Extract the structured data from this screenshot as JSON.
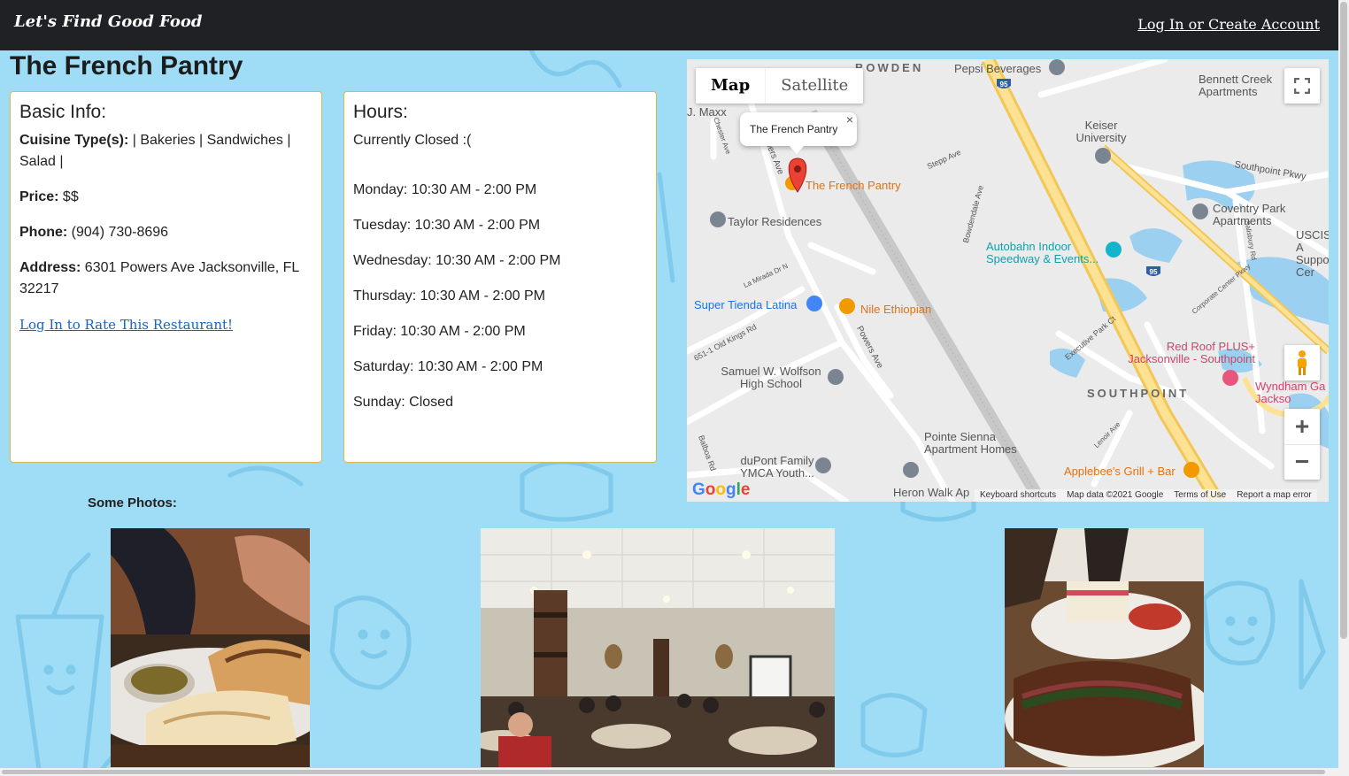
{
  "navbar": {
    "brand": "Let's Find Good Food",
    "login_link": "Log In or Create Account"
  },
  "restaurant": {
    "name": "The French Pantry"
  },
  "basic_info": {
    "heading": "Basic Info:",
    "cuisine_label": "Cuisine Type(s):",
    "cuisine_value": " | Bakeries | Sandwiches | Salad |",
    "price_label": "Price:",
    "price_value": " $$",
    "phone_label": "Phone:",
    "phone_value": " (904) 730-8696",
    "address_label": "Address:",
    "address_value": " 6301 Powers Ave Jacksonville, FL 32217",
    "rate_link": "Log In to Rate This Restaurant!"
  },
  "hours": {
    "heading": "Hours:",
    "status": "Currently Closed :(",
    "days": [
      "Monday: 10:30 AM - 2:00 PM",
      "Tuesday: 10:30 AM - 2:00 PM",
      "Wednesday: 10:30 AM - 2:00 PM",
      "Thursday: 10:30 AM - 2:00 PM",
      "Friday: 10:30 AM - 2:00 PM",
      "Saturday: 10:30 AM - 2:00 PM",
      "Sunday: Closed"
    ]
  },
  "map": {
    "type_map": "Map",
    "type_satellite": "Satellite",
    "info_window_title": "The French Pantry",
    "info_close": "×",
    "zoom_in": "+",
    "zoom_out": "−",
    "logo": "Google",
    "footer": {
      "shortcuts": "Keyboard shortcuts",
      "data": "Map data ©2021 Google",
      "terms": "Terms of Use",
      "report": "Report a map error"
    },
    "labels": {
      "bowden": "BOWDEN",
      "pepsi": "Pepsi Beverages",
      "bennett": "Bennett Creek Apartments",
      "jmaxx": "J. Maxx",
      "chester": "Chester Ave",
      "powers_top": "Powers Ave",
      "french_pantry": "The French Pantry",
      "stepp": "Stepp Ave",
      "keiser": "Keiser University",
      "southpoint_pkwy": "Southpoint Pkwy",
      "taylor": "Taylor Residences",
      "coventry": "Coventry Park Apartments",
      "uscis": "USCIS A Support Cer",
      "autobahn": "Autobahn Indoor Speedway & Events...",
      "bowdendale": "Bowdendale Ave",
      "salisbury": "Salisbury Rd",
      "la_mirada": "La Mirada Dr N",
      "super_tienda": "Super Tienda Latina",
      "nile": "Nile Ethiopian",
      "old_kings": "651-1 Old Kings Rd",
      "powers_mid": "Powers Ave",
      "executive": "Executive Park Ct",
      "corporate": "Corporate Center Pkwy",
      "red_roof": "Red Roof PLUS+ Jacksonville - Southpoint",
      "wolfson": "Samuel W. Wolfson High School",
      "southpoint": "SOUTHPOINT",
      "wyndham": "Wyndham Ga Jackso",
      "lenoir": "Lenoir Ave",
      "pointe_sienna": "Pointe Sienna Apartment Homes",
      "balboa": "Balboa Rd",
      "dupont": "duPont Family YMCA Youth...",
      "applebees": "Applebee's Grill + Bar",
      "heron": "Heron Walk Ap",
      "marriott": "M",
      "i95": "95"
    }
  },
  "photos": {
    "heading": "Some Photos:"
  },
  "colors": {
    "page_bg": "#9fdcf5",
    "navbar_bg": "#1f2125",
    "card_border": "#d9b84a",
    "link": "#1565c0",
    "map_pin": "#ea4335",
    "highway": "#f6cf65"
  },
  "icons": [
    "fullscreen-icon",
    "pegman-icon",
    "map-pin-icon",
    "close-icon"
  ]
}
